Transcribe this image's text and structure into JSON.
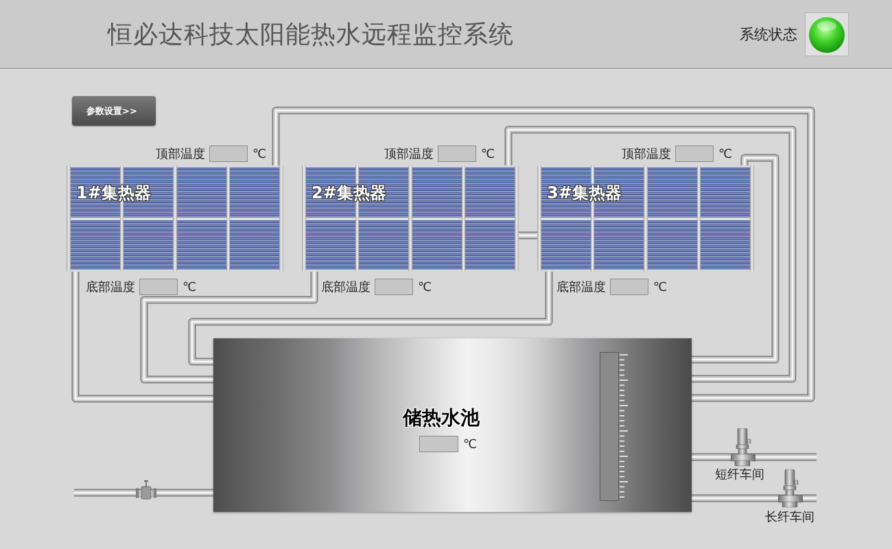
{
  "header": {
    "title": "恒必达科技太阳能热水远程监控系统",
    "status": {
      "label": "系统状态",
      "on": true
    }
  },
  "settings_button": {
    "label": "参数设置>>"
  },
  "collectors": [
    {
      "name": "1#集热器",
      "top_temperature": {
        "label": "顶部温度",
        "unit": "℃"
      },
      "bottom_temperature": {
        "label": "底部温度",
        "unit": "℃"
      }
    },
    {
      "name": "2#集热器",
      "top_temperature": {
        "label": "顶部温度",
        "unit": "℃"
      },
      "bottom_temperature": {
        "label": "底部温度",
        "unit": "℃"
      }
    },
    {
      "name": "3#集热器",
      "top_temperature": {
        "label": "顶部温度",
        "unit": "℃"
      },
      "bottom_temperature": {
        "label": "底部温度",
        "unit": "℃"
      }
    }
  ],
  "tank": {
    "name": "储热水池",
    "temperature": {
      "unit": "℃"
    }
  },
  "outlets": [
    {
      "label": "短纤车间"
    },
    {
      "label": "长纤车间"
    }
  ]
}
